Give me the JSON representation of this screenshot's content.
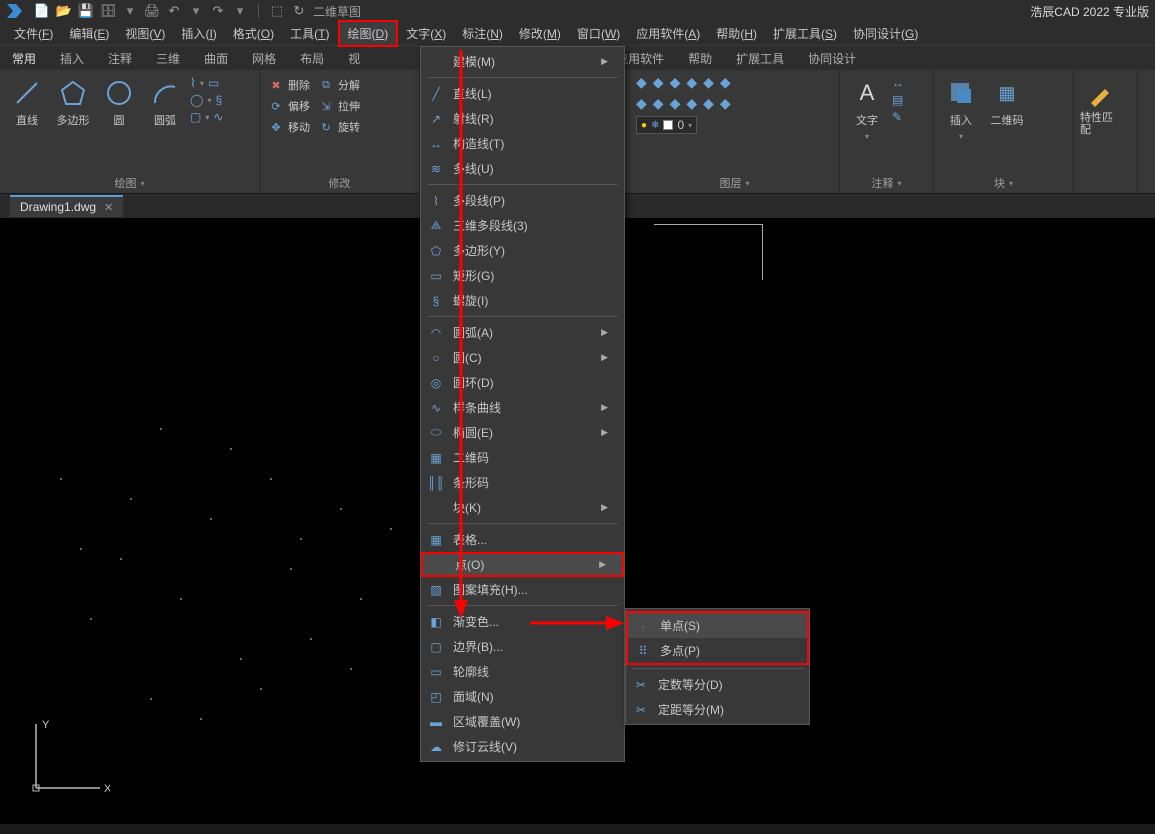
{
  "app_title": "浩辰CAD 2022 专业版",
  "qat_label": "二维草图",
  "menubar": [
    {
      "label": "文件",
      "key": "F"
    },
    {
      "label": "编辑",
      "key": "E"
    },
    {
      "label": "视图",
      "key": "V"
    },
    {
      "label": "插入",
      "key": "I"
    },
    {
      "label": "格式",
      "key": "O"
    },
    {
      "label": "工具",
      "key": "T"
    },
    {
      "label": "绘图",
      "key": "D",
      "active": true
    },
    {
      "label": "文字",
      "key": "X"
    },
    {
      "label": "标注",
      "key": "N"
    },
    {
      "label": "修改",
      "key": "M"
    },
    {
      "label": "窗口",
      "key": "W"
    },
    {
      "label": "应用软件",
      "key": "A"
    },
    {
      "label": "帮助",
      "key": "H"
    },
    {
      "label": "扩展工具",
      "key": "S"
    },
    {
      "label": "协同设计",
      "key": "G"
    }
  ],
  "ribbon_tabs": [
    "常用",
    "插入",
    "注释",
    "三维",
    "曲面",
    "网格",
    "布局",
    "视",
    "",
    "应用软件",
    "帮助",
    "扩展工具",
    "协同设计"
  ],
  "ribbon": {
    "draw_title": "绘图",
    "modify_title": "修改",
    "layer_title": "图层",
    "annot_title": "注释",
    "block_title": "块",
    "line": "直线",
    "polygon": "多边形",
    "circle": "圆",
    "arc": "圆弧",
    "delete": "删除",
    "explode": "分解",
    "offset": "偏移",
    "stretch": "拉伸",
    "move": "移动",
    "rotate": "旋转",
    "text": "文字",
    "insert": "插入",
    "qrcode": "二维码",
    "props": "特性匹配",
    "layer_input": "0"
  },
  "doc_tab": "Drawing1.dwg",
  "draw_menu": {
    "modeling": "建模(M)",
    "line": "直线(L)",
    "ray": "射线(R)",
    "xline": "构造线(T)",
    "mline": "多线(U)",
    "pline": "多段线(P)",
    "3dpoly": "三维多段线(3)",
    "polygon": "多边形(Y)",
    "rect": "矩形(G)",
    "spiral": "螺旋(I)",
    "arc": "圆弧(A)",
    "circle": "圆(C)",
    "donut": "圆环(D)",
    "spline": "样条曲线",
    "ellipse": "椭圆(E)",
    "qrcode": "二维码",
    "barcode": "条形码",
    "block": "块(K)",
    "table": "表格...",
    "point": "点(O)",
    "hatch": "图案填充(H)...",
    "gradient": "渐变色...",
    "boundary": "边界(B)...",
    "outline": "轮廓线",
    "region": "面域(N)",
    "wipeout": "区域覆盖(W)",
    "revcloud": "修订云线(V)"
  },
  "point_submenu": {
    "single": "单点(S)",
    "multi": "多点(P)",
    "divide": "定数等分(D)",
    "measure": "定距等分(M)"
  }
}
